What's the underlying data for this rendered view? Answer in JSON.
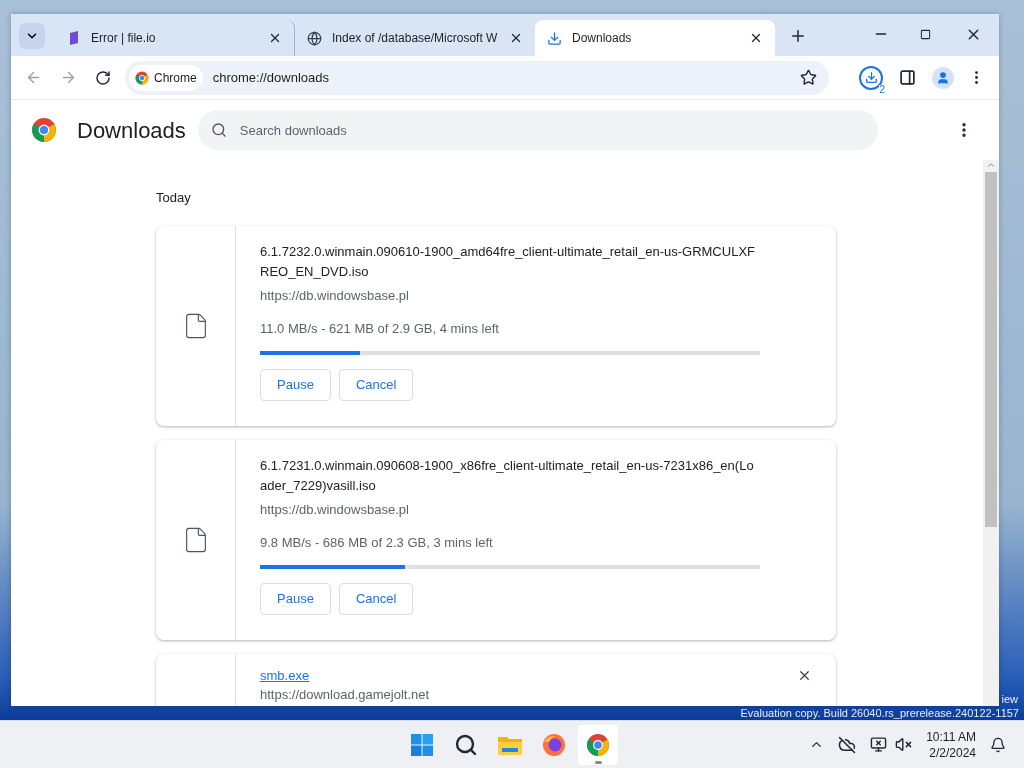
{
  "tabs": [
    {
      "kind": "fileio",
      "title": "Error | file.io",
      "selected": false
    },
    {
      "kind": "globe",
      "title": "Index of /database/Microsoft W",
      "selected": false
    },
    {
      "kind": "download",
      "title": "Downloads",
      "selected": true
    }
  ],
  "toolbar": {
    "chip": "Chrome",
    "url": "chrome://downloads",
    "download_count": "2"
  },
  "page": {
    "title": "Downloads",
    "search": {
      "placeholder": "Search downloads"
    },
    "section": "Today",
    "downloads": [
      {
        "kind": "in_progress",
        "name": "6.1.7232.0.winmain.090610-1900_amd64fre_client-ultimate_retail_en-us-GRMCULXFREO_EN_DVD.iso",
        "url": "https://db.windowsbase.pl",
        "status": "11.0 MB/s - 621 MB of 2.9 GB, 4 mins left",
        "level": 0.2,
        "buttons": [
          "Pause",
          "Cancel"
        ]
      },
      {
        "kind": "in_progress",
        "name": "6.1.7231.0.winmain.090608-1900_x86fre_client-ultimate_retail_en-us-7231x86_en(Loader_7229)vasill.iso",
        "url": "https://db.windowsbase.pl",
        "status": "9.8 MB/s - 686 MB of 2.3 GB, 3 mins left",
        "level": 0.29,
        "buttons": [
          "Pause",
          "Cancel"
        ]
      },
      {
        "kind": "complete",
        "name": "smb.exe",
        "url": "https://download.gamejolt.net"
      }
    ]
  },
  "desktop": {
    "watermark_top": "iew",
    "watermark": "Evaluation copy. Build 26040.rs_prerelease.240122-1157"
  },
  "taskbar": {
    "apps": [
      {
        "kind": "start",
        "selected": false
      },
      {
        "kind": "search",
        "selected": false
      },
      {
        "kind": "explorer",
        "selected": false
      },
      {
        "kind": "firefox",
        "selected": false
      },
      {
        "kind": "chrome",
        "selected": true
      }
    ],
    "time": "10:11 AM",
    "date": "2/2/2024"
  }
}
